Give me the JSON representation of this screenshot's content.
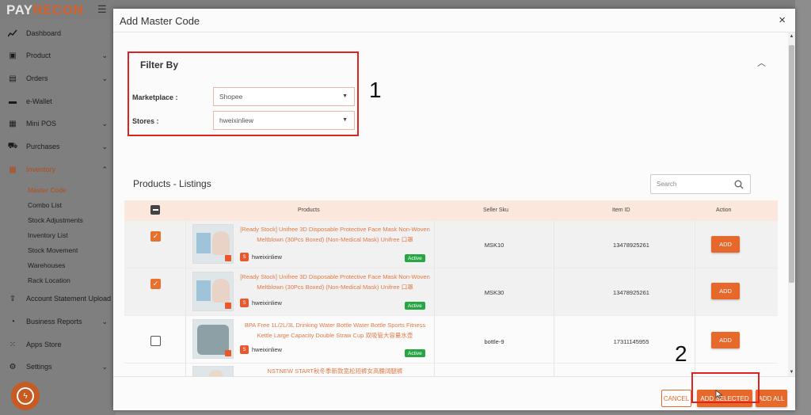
{
  "app": {
    "logo_a": "PAY",
    "logo_b": "RECON",
    "menu_icon": "hamburger-icon"
  },
  "sidebar": {
    "items": [
      {
        "label": "Dashboard",
        "icon": "chart-line-icon",
        "has_chevron": false
      },
      {
        "label": "Product",
        "icon": "box-icon",
        "has_chevron": true
      },
      {
        "label": "Orders",
        "icon": "clipboard-icon",
        "has_chevron": true
      },
      {
        "label": "e-Wallet",
        "icon": "wallet-icon",
        "has_chevron": false
      },
      {
        "label": "Mini POS",
        "icon": "pos-icon",
        "has_chevron": true
      },
      {
        "label": "Purchases",
        "icon": "truck-icon",
        "has_chevron": true
      },
      {
        "label": "Inventory",
        "icon": "boxes-icon",
        "has_chevron": true,
        "active": true
      }
    ],
    "inventory_sub": [
      "Master Code",
      "Combo List",
      "Stock Adjustments",
      "Inventory List",
      "Stock Movement",
      "Warehouses",
      "Rack Location"
    ],
    "bottom_items": [
      {
        "label": "Account Statement Upload",
        "icon": "upload-icon"
      },
      {
        "label": "Business Reports",
        "icon": "pie-chart-icon"
      },
      {
        "label": "Apps Store",
        "icon": "grid-icon"
      },
      {
        "label": "Settings",
        "icon": "gear-icon"
      }
    ]
  },
  "modal": {
    "title": "Add Master Code",
    "close": "×",
    "filter": {
      "title": "Filter By",
      "marketplace_label": "Marketplace :",
      "marketplace_value": "Shopee",
      "stores_label": "Stores :",
      "stores_value": "hweixinliew"
    },
    "annotations": {
      "one": "1",
      "two": "2"
    },
    "listings": {
      "title": "Products - Listings",
      "search_placeholder": "Search",
      "columns": [
        "Products",
        "Seller Sku",
        "Item ID",
        "Action"
      ],
      "rows": [
        {
          "checked": true,
          "name": "[Ready Stock] Unifree 3D Disposable Protective Face Mask Non-Woven Meltblown (30Pcs Boxed) (Non-Medical Mask) Unifree 口罩",
          "store": "hweixinliew",
          "status": "Active",
          "sku": "MSK10",
          "item_id": "13478925261",
          "action": "ADD"
        },
        {
          "checked": true,
          "name": "[Ready Stock] Unifree 3D Disposable Protective Face Mask Non-Woven Meltblown (30Pcs Boxed) (Non-Medical Mask) Unifree 口罩",
          "store": "hweixinliew",
          "status": "Active",
          "sku": "MSK30",
          "item_id": "13478925261",
          "action": "ADD"
        },
        {
          "checked": false,
          "name": "BPA Free 1L/2L/3L Drinking Water Bottle Water Bottle Sports Fitness Kettle Large Capacity Double Straw Cup 双吸管大容量水壶",
          "store": "hweixinliew",
          "status": "Active",
          "sku": "bottle-9",
          "item_id": "17311145955",
          "action": "ADD"
        },
        {
          "checked": false,
          "name": "NSTNEW START秋冬季新款宽松短裤女高腰阔腿裤",
          "store": "",
          "status": "",
          "sku": "",
          "item_id": "",
          "action": ""
        }
      ]
    },
    "footer": {
      "cancel": "CANCEL",
      "add_selected": "ADD SELECTED",
      "add_all": "ADD ALL"
    }
  },
  "colors": {
    "accent": "#e6692b",
    "annotation_box": "#e02222",
    "active_badge": "#27a744",
    "header_row": "#fbe7db"
  }
}
